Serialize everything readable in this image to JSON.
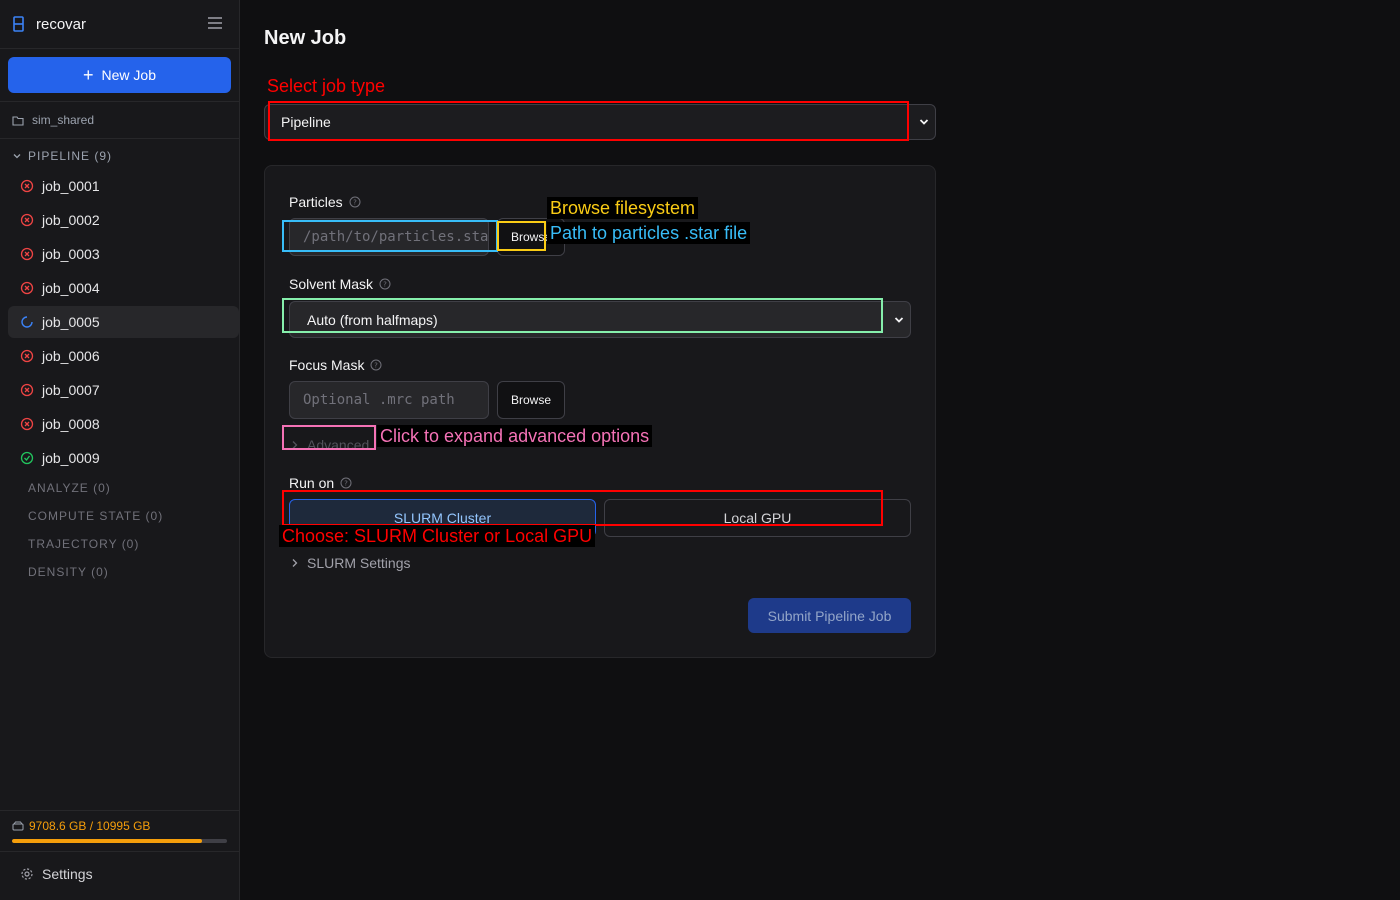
{
  "sidebar": {
    "brand": "recovar",
    "new_job_label": "New Job",
    "workspace": "sim_shared",
    "pipeline_section": "PIPELINE (9)",
    "jobs": [
      {
        "name": "job_0001",
        "status": "failed"
      },
      {
        "name": "job_0002",
        "status": "failed"
      },
      {
        "name": "job_0003",
        "status": "failed"
      },
      {
        "name": "job_0004",
        "status": "failed"
      },
      {
        "name": "job_0005",
        "status": "running"
      },
      {
        "name": "job_0006",
        "status": "failed"
      },
      {
        "name": "job_0007",
        "status": "failed"
      },
      {
        "name": "job_0008",
        "status": "failed"
      },
      {
        "name": "job_0009",
        "status": "completed"
      }
    ],
    "categories": [
      "ANALYZE (0)",
      "COMPUTE STATE (0)",
      "TRAJECTORY (0)",
      "DENSITY (0)"
    ],
    "storage": {
      "label": "9708.6 GB / 10995 GB",
      "used_gb": 9708.6,
      "total_gb": 10995
    },
    "settings_label": "Settings"
  },
  "main": {
    "title": "New Job",
    "job_type": "Pipeline",
    "form": {
      "particles_label": "Particles",
      "particles_placeholder": "/path/to/particles.star",
      "browse_label": "Browse",
      "solvent_mask_label": "Solvent Mask",
      "solvent_mask_value": "Auto (from halfmaps)",
      "focus_mask_label": "Focus Mask",
      "focus_mask_placeholder": "Optional .mrc path",
      "advanced_label": "Advanced",
      "run_on_label": "Run on",
      "run_options": [
        "SLURM Cluster",
        "Local GPU"
      ],
      "slurm_settings_label": "SLURM Settings",
      "submit_label": "Submit Pipeline Job"
    }
  },
  "annotations": {
    "job_type": "Select job type",
    "browse": "Browse filesystem",
    "particles": "Path to particles .star file",
    "advanced": "Click to expand advanced options",
    "run_on": "Choose: SLURM Cluster or Local GPU"
  },
  "colors": {
    "accent": "#2563eb",
    "failed": "#ef4444",
    "running": "#3b82f6",
    "completed": "#22c55e",
    "storage": "#f59e0b",
    "ann_red": "#ff0000",
    "ann_yellow": "#facc15",
    "ann_cyan": "#38bdf8",
    "ann_green": "#86efac",
    "ann_pink": "#f472b6"
  }
}
